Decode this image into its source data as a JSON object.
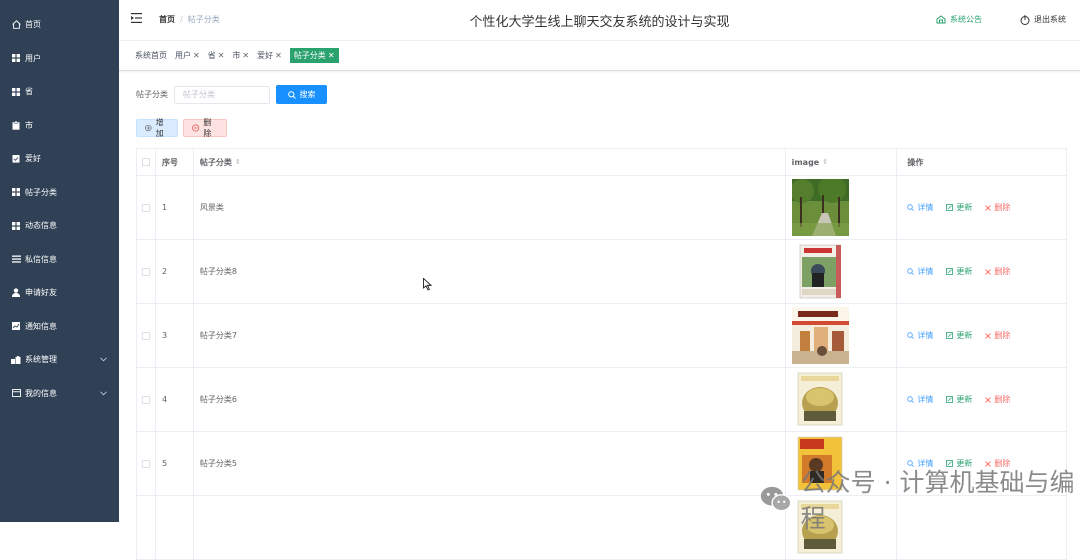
{
  "sidebar": {
    "items": [
      {
        "label": "首页",
        "icon": "home-icon"
      },
      {
        "label": "用户",
        "icon": "grid-icon"
      },
      {
        "label": "省",
        "icon": "grid-icon"
      },
      {
        "label": "市",
        "icon": "clipboard-icon"
      },
      {
        "label": "爱好",
        "icon": "checklist-icon"
      },
      {
        "label": "帖子分类",
        "icon": "grid-icon"
      },
      {
        "label": "动态信息",
        "icon": "grid-icon"
      },
      {
        "label": "私信信息",
        "icon": "list-icon"
      },
      {
        "label": "申请好友",
        "icon": "user-icon"
      },
      {
        "label": "通知信息",
        "icon": "chart-icon"
      },
      {
        "label": "系统管理",
        "icon": "settings-icon"
      },
      {
        "label": "我的信息",
        "icon": "profile-icon"
      }
    ],
    "bg_color": "#304156"
  },
  "header": {
    "breadcrumb_home": "首页",
    "breadcrumb_sep": "/",
    "breadcrumb_current": "帖子分类",
    "title": "个性化大学生线上聊天交友系统的设计与实现",
    "notice_label": "系统公告",
    "logout_label": "退出系统"
  },
  "tags": [
    {
      "label": "系统首页",
      "closable": false,
      "active": false
    },
    {
      "label": "用户",
      "closable": true,
      "active": false
    },
    {
      "label": "省",
      "closable": true,
      "active": false
    },
    {
      "label": "市",
      "closable": true,
      "active": false
    },
    {
      "label": "爱好",
      "closable": true,
      "active": false
    },
    {
      "label": "帖子分类",
      "closable": true,
      "active": true
    }
  ],
  "search": {
    "label": "帖子分类",
    "placeholder": "帖子分类",
    "button_label": "搜索"
  },
  "toolbar": {
    "add_label": "增加",
    "delete_label": "删除"
  },
  "table": {
    "headers": {
      "index": "序号",
      "name": "帖子分类",
      "image": "image",
      "ops": "操作"
    },
    "rows": [
      {
        "index": "1",
        "name": "风景类"
      },
      {
        "index": "2",
        "name": "帖子分类8"
      },
      {
        "index": "3",
        "name": "帖子分类7"
      },
      {
        "index": "4",
        "name": "帖子分类6"
      },
      {
        "index": "5",
        "name": "帖子分类5"
      }
    ],
    "op_detail": "详情",
    "op_update": "更新",
    "op_delete": "删除"
  },
  "watermark": {
    "text": "公众号 · 计算机基础与编程"
  },
  "colors": {
    "accent_green": "#2aa26e",
    "primary_blue": "#1890ff",
    "danger_red": "#f56c6c"
  }
}
